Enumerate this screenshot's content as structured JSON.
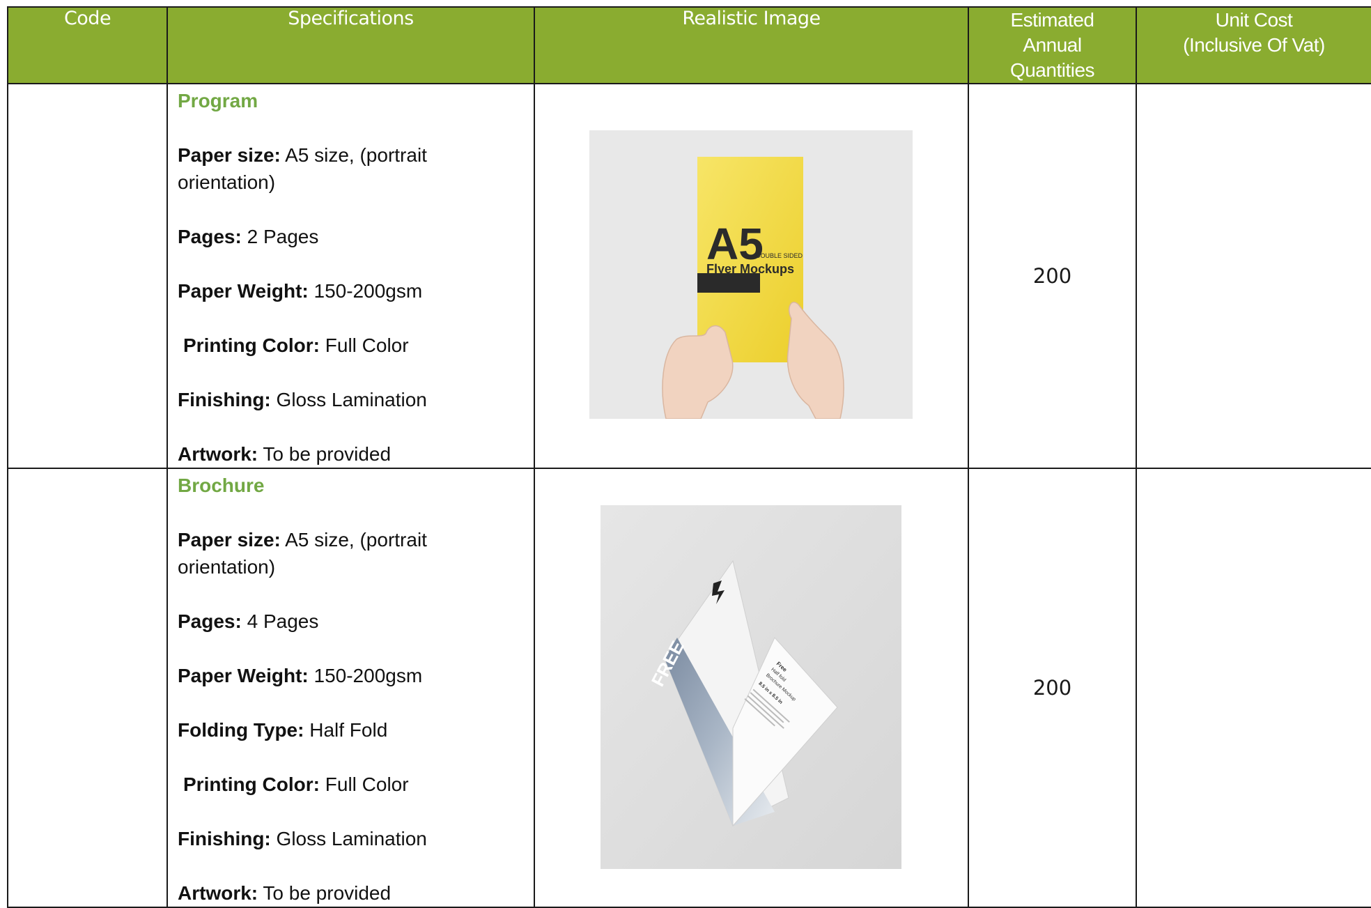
{
  "header": {
    "code": "Code",
    "specifications": "Specifications",
    "realistic_image": "Realistic Image",
    "quantities_l1": "Estimated",
    "quantities_l2": "Annual",
    "quantities_l3": "Quantities",
    "cost_l1": "Unit Cost",
    "cost_l2": "(Inclusive Of Vat)"
  },
  "items": [
    {
      "code": "",
      "title": "Program",
      "specs": [
        {
          "label": "Paper size:",
          "value": " A5 size, (portrait orientation)"
        },
        {
          "label": "Pages:",
          "value": " 2 Pages"
        },
        {
          "label": "Paper Weight:",
          "value": " 150-200gsm"
        },
        {
          "label": "Printing Color:",
          "value": " Full Color"
        },
        {
          "label": "Finishing:",
          "value": " Gloss Lamination"
        },
        {
          "label": "Artwork:",
          "value": " To be provided"
        }
      ],
      "image": {
        "big": "A5",
        "small": "DOUBLE SIDED",
        "caption": "Flyer Mockups"
      },
      "quantity": "200",
      "unit_cost": ""
    },
    {
      "code": "",
      "title": "Brochure",
      "specs": [
        {
          "label": "Paper size:",
          "value": " A5 size, (portrait orientation)"
        },
        {
          "label": "Pages:",
          "value": " 4 Pages"
        },
        {
          "label": "Paper Weight:",
          "value": " 150-200gsm"
        },
        {
          "label": "Folding Type:",
          "value": " Half Fold"
        },
        {
          "label": "Printing Color:",
          "value": " Full Color"
        },
        {
          "label": "Finishing:",
          "value": " Gloss Lamination"
        },
        {
          "label": "Artwork:",
          "value": " To be provided"
        }
      ],
      "image": {
        "free": "FREE",
        "t1": "Free",
        "t2": "Half fold",
        "t3": "Brochure Mockup",
        "t4": "8.5 in x 8.5 in"
      },
      "quantity": "200",
      "unit_cost": ""
    }
  ],
  "colors": {
    "header_bg": "#8aac30",
    "title_green": "#72a844",
    "flyer_yellow": "#f5dc3c"
  }
}
